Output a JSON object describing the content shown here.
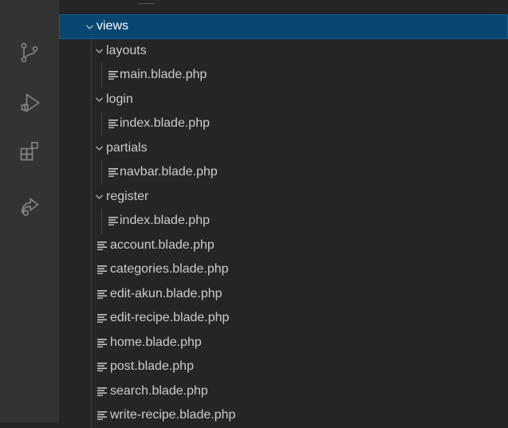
{
  "activity_bar": {
    "icons": [
      "source-control-icon",
      "run-debug-icon",
      "extensions-icon",
      "remote-share-icon"
    ]
  },
  "explorer": {
    "tree": [
      {
        "label": "views",
        "type": "folder",
        "depth": 0,
        "expanded": true,
        "selected": true
      },
      {
        "label": "layouts",
        "type": "folder",
        "depth": 1,
        "expanded": true
      },
      {
        "label": "main.blade.php",
        "type": "file",
        "depth": 2
      },
      {
        "label": "login",
        "type": "folder",
        "depth": 1,
        "expanded": true
      },
      {
        "label": "index.blade.php",
        "type": "file",
        "depth": 2
      },
      {
        "label": "partials",
        "type": "folder",
        "depth": 1,
        "expanded": true
      },
      {
        "label": "navbar.blade.php",
        "type": "file",
        "depth": 2
      },
      {
        "label": "register",
        "type": "folder",
        "depth": 1,
        "expanded": true
      },
      {
        "label": "index.blade.php",
        "type": "file",
        "depth": 2
      },
      {
        "label": "account.blade.php",
        "type": "file",
        "depth": 1
      },
      {
        "label": "categories.blade.php",
        "type": "file",
        "depth": 1
      },
      {
        "label": "edit-akun.blade.php",
        "type": "file",
        "depth": 1
      },
      {
        "label": "edit-recipe.blade.php",
        "type": "file",
        "depth": 1
      },
      {
        "label": "home.blade.php",
        "type": "file",
        "depth": 1
      },
      {
        "label": "post.blade.php",
        "type": "file",
        "depth": 1
      },
      {
        "label": "search.blade.php",
        "type": "file",
        "depth": 1
      },
      {
        "label": "write-recipe.blade.php",
        "type": "file",
        "depth": 1
      }
    ]
  },
  "colors": {
    "selection": "#094771",
    "selection_border": "#0e639c",
    "text": "#cccccc",
    "icon": "#858585"
  }
}
